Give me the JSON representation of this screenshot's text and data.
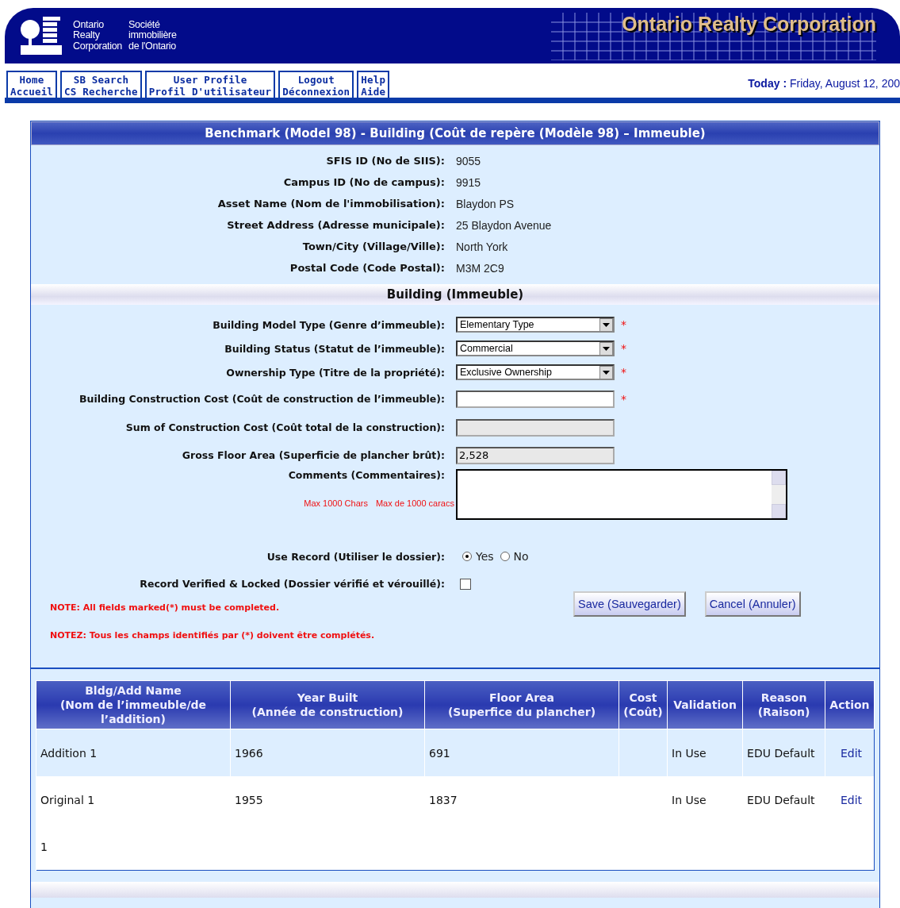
{
  "header": {
    "logo_en": [
      "Ontario",
      "Realty",
      "Corporation"
    ],
    "logo_fr": [
      "Société",
      "immobilière",
      "de l'Ontario"
    ],
    "banner": "Ontario Realty Corporation"
  },
  "nav": [
    {
      "line1": "Home",
      "line2": "Accueil"
    },
    {
      "line1": "SB Search",
      "line2": "CS Recherche"
    },
    {
      "line1": "User Profile",
      "line2": "Profil D'utilisateur"
    },
    {
      "line1": "Logout",
      "line2": "Déconnexion"
    },
    {
      "line1": "Help",
      "line2": "Aide"
    }
  ],
  "today": {
    "label": "Today :",
    "value": "Friday, August 12, 200"
  },
  "panel_title": "Benchmark (Model 98) - Building (Coût de repère (Modèle 98) – Immeuble)",
  "info": [
    {
      "label": "SFIS ID (No de SIIS):",
      "value": "9055"
    },
    {
      "label": "Campus ID (No de campus):",
      "value": "9915"
    },
    {
      "label": "Asset Name (Nom de l'immobilisation):",
      "value": "Blaydon PS"
    },
    {
      "label": "Street Address (Adresse municipale):",
      "value": "25 Blaydon Avenue"
    },
    {
      "label": "Town/City (Village/Ville):",
      "value": "North York"
    },
    {
      "label": "Postal Code (Code Postal):",
      "value": "M3M 2C9"
    }
  ],
  "section_title": "Building (Immeuble)",
  "fields": [
    {
      "kind": "select",
      "label": "Building Model Type (Genre d’immeuble):",
      "value": "Elementary Type",
      "marker": "*"
    },
    {
      "kind": "select",
      "label": "Building Status (Statut de l’immeuble):",
      "value": "Commercial",
      "marker": "*"
    },
    {
      "kind": "select",
      "label": "Ownership Type (Titre de la propriété):",
      "value": "Exclusive Ownership",
      "marker": "*"
    },
    {
      "kind": "text",
      "label": "Building Construction Cost (Coût de construction de l’immeuble):",
      "marker": "*"
    },
    {
      "kind": "readonly",
      "label": "Sum of Construction Cost (Coût total de la construction):"
    },
    {
      "kind": "readonly",
      "label": "Gross Floor Area (Superficie de plancher brût):",
      "value": "2,528"
    },
    {
      "kind": "textarea",
      "label": "Comments (Commentaires):",
      "hints": [
        "Max 1000 Chars",
        "Max de 1000 caracs"
      ]
    },
    {
      "kind": "radio",
      "label": "Use Record (Utiliser le dossier):",
      "options": [
        {
          "label": "Yes",
          "selected": true
        },
        {
          "label": "No",
          "selected": false
        }
      ]
    },
    {
      "kind": "checkbox",
      "label": "Record Verified & Locked (Dossier vérifié et vérouillé):",
      "checked": false
    }
  ],
  "notes": [
    "NOTE: All fields marked(*) must be completed.",
    "NOTEZ: Tous les champs identifiés par (*) doivent être complétés."
  ],
  "buttons": [
    "Save (Sauvegarder)",
    "Cancel (Annuler)"
  ],
  "table": {
    "columns": [
      "Bldg/Add Name\n(Nom de l’immeuble/de l’addition)",
      "Year Built\n(Année de construction)",
      "Floor Area\n(Superfice du plancher)",
      "Cost\n(Coût)",
      "Validation",
      "Reason\n(Raison)",
      "Action"
    ],
    "rows": [
      [
        "Addition 1",
        "1966",
        "691",
        "",
        "In Use",
        "EDU Default",
        "Edit"
      ],
      [
        "Original 1",
        "1955",
        "1837",
        "",
        "In Use",
        "EDU Default",
        "Edit"
      ]
    ],
    "footer": "1"
  }
}
